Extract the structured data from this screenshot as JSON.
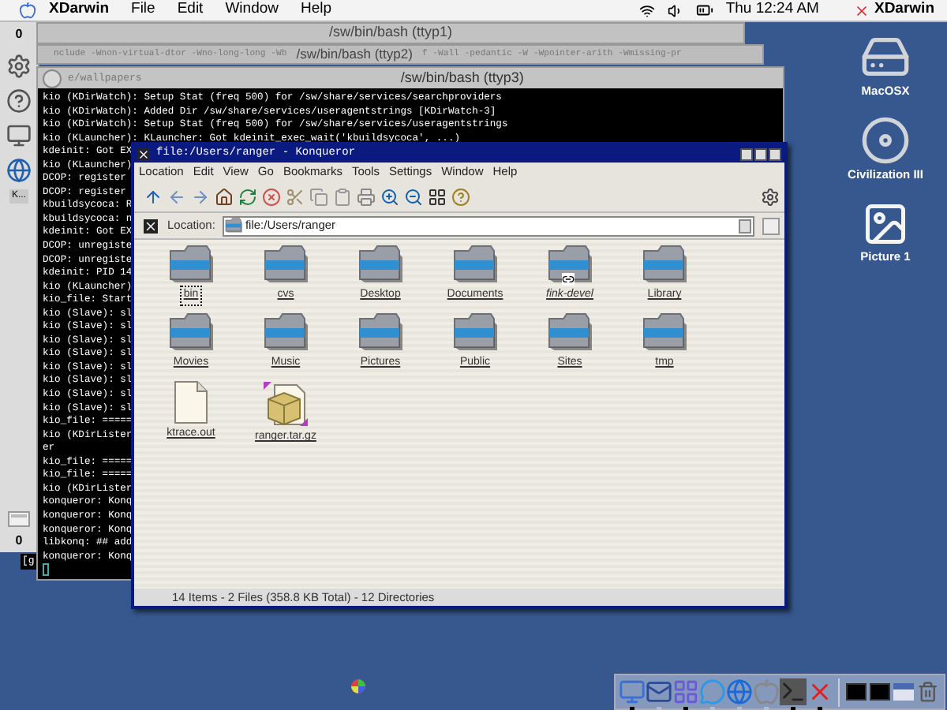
{
  "menu_bar": {
    "app_name": "XDarwin",
    "menus": [
      "File",
      "Edit",
      "Window",
      "Help"
    ],
    "clock": "Thu 12:24 AM",
    "right_app": "XDarwin"
  },
  "side_dock": {
    "top_label": "0",
    "bottom_label": "0",
    "minimized_label": "K..."
  },
  "terminals": [
    {
      "title": "/sw/bin/bash  (ttyp1)"
    },
    {
      "title": "/sw/bin/bash  (ttyp2)",
      "left_text": "nclude -Wnon-virtual-dtor -Wno-long-long -Wb",
      "right_text": "f -Wall -pedantic -W -Wpointer-arith -Wmissing-pr"
    },
    {
      "title": "/sw/bin/bash  (ttyp3)",
      "left_text": "e/wallpapers",
      "prompt_fragment": "[g",
      "lines": [
        "kio (KDirWatch):  Setup Stat (freq 500) for /sw/share/services/searchproviders",
        "kio (KDirWatch): Added Dir /sw/share/services/useragentstrings [KDirWatch-3]",
        "kio (KDirWatch):  Setup Stat (freq 500) for /sw/share/services/useragentstrings",
        "kio (KLauncher): KLauncher: Got kdeinit_exec_wait('kbuildsycoca', ...)",
        "kdeinit: Got EX",
        "kio (KLauncher)",
        "DCOP: register",
        "DCOP: register",
        "kbuildsycoca: R",
        "kbuildsycoca: n",
        "kdeinit: Got EX",
        "DCOP: unregiste",
        "DCOP: unregiste",
        "kdeinit: PID 14",
        "kio (KLauncher)",
        "kio_file: Start",
        "kio (Slave): sl",
        "kio (Slave): sl",
        "kio (Slave): sl",
        "kio (Slave): sl",
        "kio (Slave): sl",
        "kio (Slave): sl",
        "kio (Slave): sl",
        "kio (Slave): sl",
        "kio_file: =====",
        "kio (KDirLister",
        "er",
        "kio_file: =====",
        "kio_file: =====",
        "kio (KDirLister",
        "konqueror: Konq",
        "konqueror: Konq",
        "konqueror: Konq",
        "libkonq: ## add",
        "konqueror: Konq"
      ]
    }
  ],
  "konqueror": {
    "title": "file:/Users/ranger - Konqueror",
    "menus": [
      "Location",
      "Edit",
      "View",
      "Go",
      "Bookmarks",
      "Tools",
      "Settings",
      "Window",
      "Help"
    ],
    "location_label": "Location:",
    "location": "file:/Users/ranger",
    "items": [
      {
        "name": "bin",
        "kind": "folder",
        "link": false,
        "selected": true
      },
      {
        "name": "cvs",
        "kind": "folder",
        "link": false,
        "selected": false
      },
      {
        "name": "Desktop",
        "kind": "folder",
        "link": false,
        "selected": false
      },
      {
        "name": "Documents",
        "kind": "folder",
        "link": false,
        "selected": false
      },
      {
        "name": "fink-devel",
        "kind": "folder",
        "link": true,
        "selected": false
      },
      {
        "name": "Library",
        "kind": "folder",
        "link": false,
        "selected": false
      },
      {
        "name": "Movies",
        "kind": "folder",
        "link": false,
        "selected": false
      },
      {
        "name": "Music",
        "kind": "folder",
        "link": false,
        "selected": false
      },
      {
        "name": "Pictures",
        "kind": "folder",
        "link": false,
        "selected": false
      },
      {
        "name": "Public",
        "kind": "folder",
        "link": false,
        "selected": false
      },
      {
        "name": "Sites",
        "kind": "folder",
        "link": false,
        "selected": false
      },
      {
        "name": "tmp",
        "kind": "folder",
        "link": false,
        "selected": false
      },
      {
        "name": "ktrace.out",
        "kind": "file",
        "link": false,
        "selected": false
      },
      {
        "name": "ranger.tar.gz",
        "kind": "archive",
        "link": false,
        "selected": false
      }
    ],
    "status": "14 Items - 2 Files (358.8 KB Total) - 12 Directories"
  },
  "desktop_icons": [
    {
      "label": "MacOSX",
      "kind": "disk"
    },
    {
      "label": "Civilization III",
      "kind": "cd"
    },
    {
      "label": "Picture 1",
      "kind": "image"
    }
  ],
  "dock": {
    "apps": [
      {
        "kind": "finder",
        "running": true
      },
      {
        "kind": "mail",
        "running": false
      },
      {
        "kind": "m",
        "running": true
      },
      {
        "kind": "chat",
        "running": false
      },
      {
        "kind": "browser",
        "running": false
      },
      {
        "kind": "system",
        "running": false
      },
      {
        "kind": "terminal",
        "running": true
      },
      {
        "kind": "x",
        "running": true
      }
    ],
    "windows": [
      {
        "kind": "black"
      },
      {
        "kind": "black"
      },
      {
        "kind": "window"
      },
      {
        "kind": "trash"
      }
    ]
  }
}
